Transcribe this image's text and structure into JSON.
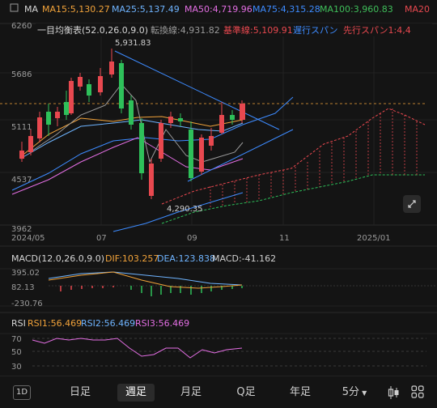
{
  "ma_row": {
    "label": "MA",
    "ma15": {
      "text": "MA15:5,130.27",
      "color": "#f2a33a"
    },
    "ma25": {
      "text": "MA25:5,137.49",
      "color": "#6fb4ff"
    },
    "ma50": {
      "text": "MA50:4,719.96",
      "color": "#e36ee3"
    },
    "ma75": {
      "text": "MA75:4,315.28",
      "color": "#3d8bff"
    },
    "ma100": {
      "text": "MA100:3,960.83",
      "color": "#3fbf5a"
    },
    "ma200": {
      "text": "MA20",
      "color": "#e8484f"
    }
  },
  "ichimoku_row": {
    "label": "一目均衡表(52.0,26.0,9.0)",
    "tenkan": {
      "text": "転換線:4,931.82",
      "color": "#9a9a9a"
    },
    "kijun": {
      "text": "基準線:5,109.91",
      "color": "#e8484f"
    },
    "chikou": {
      "text": "遅行スパン",
      "color": "#3d8bff"
    },
    "senkou": {
      "text": "先行スパン1:4,4",
      "color": "#e8484f"
    }
  },
  "price_axis": [
    "6260",
    "5686",
    "5111",
    "4537",
    "3962"
  ],
  "time_axis": [
    "2024/05",
    "07",
    "09",
    "11",
    "2025/01"
  ],
  "annotations": {
    "high": "5,931.83",
    "low": "4,290.35"
  },
  "macd_row": {
    "label": "MACD(12.0,26.0,9.0)",
    "dif": {
      "text": "DIF:103.257",
      "color": "#f2a33a"
    },
    "dea": {
      "text": "DEA:123.838",
      "color": "#6fb4ff"
    },
    "macd": {
      "text": "MACD:-41.162",
      "color": "#cfcfcf"
    },
    "axis": [
      "395.02",
      "82.13",
      "-230.76"
    ]
  },
  "rsi_row": {
    "label": "RSI",
    "rsi1": {
      "text": "RSI1:56.469",
      "color": "#f2a33a"
    },
    "rsi2": {
      "text": "RSI2:56.469",
      "color": "#6fb4ff"
    },
    "rsi3": {
      "text": "RSI3:56.469",
      "color": "#e36ee3"
    },
    "axis": [
      "70",
      "50",
      "30"
    ]
  },
  "toolbar": {
    "icon_1d": "1D",
    "items": [
      "日足",
      "週足",
      "月足",
      "Q足",
      "年足",
      "5分"
    ],
    "active": "週足"
  },
  "colors": {
    "up": "#e8484f",
    "down": "#2ec05a",
    "background": "#141414"
  }
}
